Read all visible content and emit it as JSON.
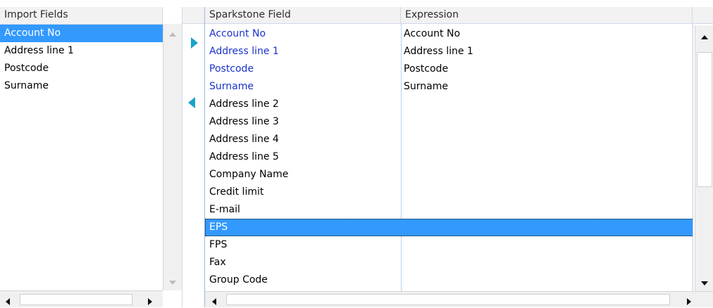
{
  "import_fields": {
    "header": "Import Fields",
    "items": [
      "Account No",
      "Address line 1",
      "Postcode",
      "Surname"
    ],
    "selected_index": 0
  },
  "mapping": {
    "headers": {
      "field": "Sparkstone Field",
      "expression": "Expression"
    },
    "rows": [
      {
        "field": "Account No",
        "expression": "Account No",
        "mapped": true
      },
      {
        "field": "Address line 1",
        "expression": "Address line 1",
        "mapped": true
      },
      {
        "field": "Postcode",
        "expression": "Postcode",
        "mapped": true
      },
      {
        "field": "Surname",
        "expression": "Surname",
        "mapped": true
      },
      {
        "field": "Address line 2",
        "expression": "",
        "mapped": false
      },
      {
        "field": "Address line 3",
        "expression": "",
        "mapped": false
      },
      {
        "field": "Address line 4",
        "expression": "",
        "mapped": false
      },
      {
        "field": "Address line 5",
        "expression": "",
        "mapped": false
      },
      {
        "field": "Company Name",
        "expression": "",
        "mapped": false
      },
      {
        "field": "Credit limit",
        "expression": "",
        "mapped": false
      },
      {
        "field": "E-mail",
        "expression": "",
        "mapped": false
      },
      {
        "field": "EPS",
        "expression": "",
        "mapped": false
      },
      {
        "field": "FPS",
        "expression": "",
        "mapped": false
      },
      {
        "field": "Fax",
        "expression": "",
        "mapped": false
      },
      {
        "field": "Group Code",
        "expression": "",
        "mapped": false
      }
    ],
    "selected_index": 11
  },
  "colors": {
    "selection": "#3399ff",
    "mapped_text": "#1a33cc",
    "arrow_fill": "#1aa3c8"
  },
  "icons": {
    "add": "triangle-right-icon",
    "remove": "triangle-left-icon"
  }
}
